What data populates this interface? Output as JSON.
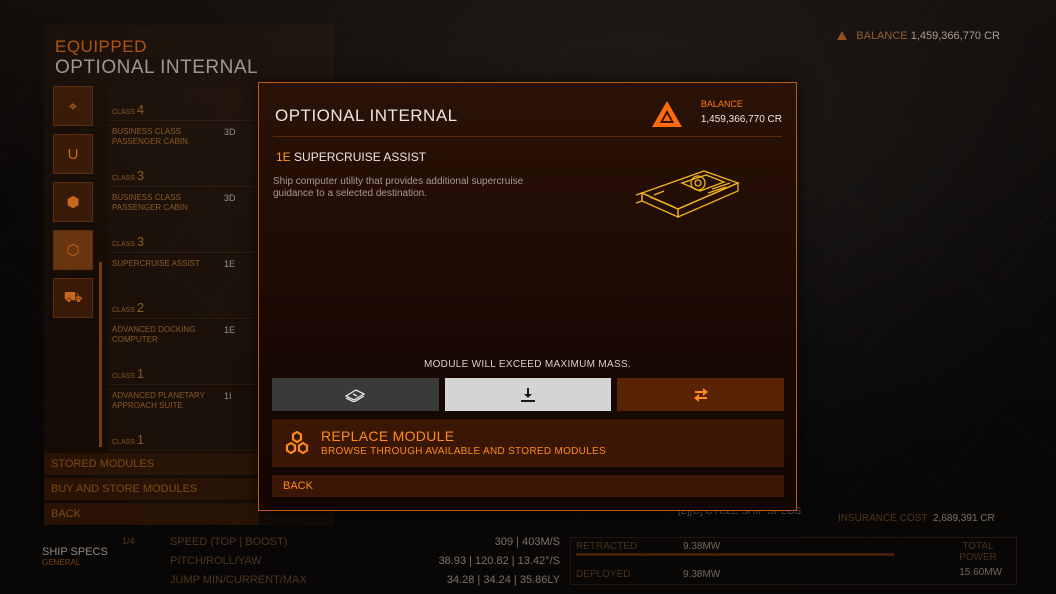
{
  "background": {
    "header_line1": "EQUIPPED",
    "header_line2": "OPTIONAL INTERNAL",
    "top_balance_label": "BALANCE",
    "top_balance_value": "1,459,366,770 CR",
    "slots": [
      {
        "name": "",
        "class_label": "CLASS",
        "class_num": "4",
        "rating": ""
      },
      {
        "name": "BUSINESS CLASS PASSENGER CABIN",
        "class_label": "CLASS",
        "class_num": "3",
        "rating": "3D"
      },
      {
        "name": "BUSINESS CLASS PASSENGER CABIN",
        "class_label": "CLASS",
        "class_num": "3",
        "rating": "3D"
      },
      {
        "name": "SUPERCRUISE ASSIST",
        "class_label": "CLASS",
        "class_num": "2",
        "rating": "1E"
      },
      {
        "name": "ADVANCED DOCKING COMPUTER",
        "class_label": "CLASS",
        "class_num": "1",
        "rating": "1E"
      },
      {
        "name": "ADVANCED PLANETARY APPROACH SUITE",
        "class_label": "CLASS",
        "class_num": "1",
        "rating": "1I"
      }
    ],
    "menu": [
      "STORED MODULES",
      "BUY AND STORE MODULES",
      "BACK"
    ],
    "ship_specs": {
      "title": "SHIP SPECS",
      "sub": "GENERAL",
      "page": "1/4"
    },
    "specs_rows": [
      {
        "label": "SPEED (TOP | BOOST)",
        "value": "309 | 403M/S"
      },
      {
        "label": "PITCH/ROLL/YAW",
        "value": "38.93 | 120.82 | 13.42°/S"
      },
      {
        "label": "JUMP MIN/CURRENT/MAX",
        "value": "34.28 | 34.24 | 35.86LY"
      }
    ],
    "power": {
      "retracted_label": "RETRACTED",
      "retracted_value": "9.38MW",
      "deployed_label": "DEPLOYED",
      "deployed_value": "9.38MW",
      "total_label": "TOTAL POWER",
      "total_value": "15.60MW"
    },
    "cycle_hint": "[Z][C] CYCLE SHIP SPECS",
    "insurance_label": "INSURANCE COST",
    "insurance_value": "2,689,391 CR"
  },
  "modal": {
    "title": "OPTIONAL INTERNAL",
    "balance_label": "BALANCE",
    "balance_value": "1,459,366,770 CR",
    "module_grade": "1E",
    "module_name": "SUPERCRUISE ASSIST",
    "description": "Ship computer utility that provides additional supercruise guidance to a selected destination.",
    "warning": "MODULE WILL EXCEED MAXIMUM MASS.",
    "buttons": {
      "buy_icon": "credits-icon",
      "store_icon": "download-icon",
      "swap_icon": "swap-arrows-icon"
    },
    "replace_title": "REPLACE MODULE",
    "replace_sub": "BROWSE THROUGH AVAILABLE AND STORED MODULES",
    "back": "BACK"
  },
  "colors": {
    "accent": "#ff8a1c",
    "panel": "#3a1604",
    "border": "#c05a14"
  }
}
